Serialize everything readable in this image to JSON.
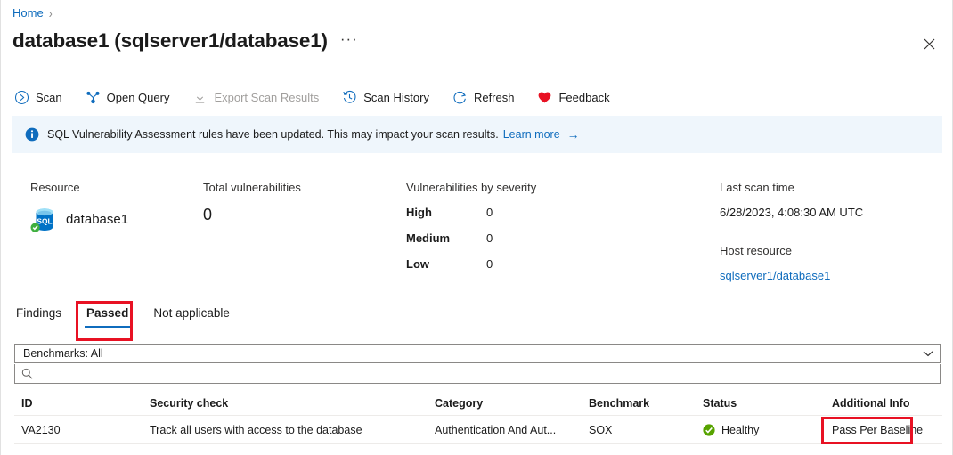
{
  "breadcrumb": {
    "home": "Home",
    "separator": "›"
  },
  "header": {
    "title": "database1 (sqlserver1/database1)",
    "ellipsis": "···",
    "close_icon": "close-icon"
  },
  "toolbar": {
    "items": [
      {
        "label": "Scan",
        "icon": "scan-icon",
        "disabled": false
      },
      {
        "label": "Open Query",
        "icon": "open-query-icon",
        "disabled": false
      },
      {
        "label": "Export Scan Results",
        "icon": "download-icon",
        "disabled": true
      },
      {
        "label": "Scan History",
        "icon": "history-icon",
        "disabled": false
      },
      {
        "label": "Refresh",
        "icon": "refresh-icon",
        "disabled": false
      },
      {
        "label": "Feedback",
        "icon": "heart-icon",
        "disabled": false
      }
    ]
  },
  "banner": {
    "icon": "info-icon",
    "message": "SQL Vulnerability Assessment rules have been updated. This may impact your scan results.",
    "link": "Learn more",
    "arrow": "→",
    "background": "#eff6fc",
    "icon_color": "#0f6cbd"
  },
  "summary": {
    "resource": {
      "label": "Resource",
      "name": "database1",
      "icon": "sql-database-icon"
    },
    "total_vulnerabilities": {
      "label": "Total vulnerabilities",
      "value": "0"
    },
    "by_severity": {
      "label": "Vulnerabilities by severity",
      "rows": [
        {
          "name": "High",
          "value": "0"
        },
        {
          "name": "Medium",
          "value": "0"
        },
        {
          "name": "Low",
          "value": "0"
        }
      ]
    },
    "last_scan": {
      "label": "Last scan time",
      "value": "6/28/2023, 4:08:30 AM UTC"
    },
    "host_resource": {
      "label": "Host resource",
      "value": "sqlserver1/database1"
    }
  },
  "tabs": {
    "items": [
      {
        "label": "Findings",
        "active": false
      },
      {
        "label": "Passed",
        "active": true
      },
      {
        "label": "Not applicable",
        "active": false
      }
    ],
    "accent": "#0f6cbd"
  },
  "filters": {
    "benchmarks": {
      "value": "Benchmarks: All",
      "chevron": "chevron-down-icon"
    },
    "search": {
      "value": "",
      "placeholder": "",
      "icon": "search-icon"
    }
  },
  "table": {
    "columns": [
      "ID",
      "Security check",
      "Category",
      "Benchmark",
      "Status",
      "Additional Info"
    ],
    "rows": [
      {
        "id": "VA2130",
        "security_check": "Track all users with access to the database",
        "category": "Authentication And Aut...",
        "benchmark": "SOX",
        "status": "Healthy",
        "status_icon": "healthy-check-icon",
        "status_color": "#57a300",
        "additional_info": "Pass Per Baseline"
      }
    ]
  },
  "annotations": {
    "color": "#e81123",
    "boxes": [
      {
        "name": "passed-tab-highlight"
      },
      {
        "name": "additional-info-highlight"
      }
    ]
  }
}
